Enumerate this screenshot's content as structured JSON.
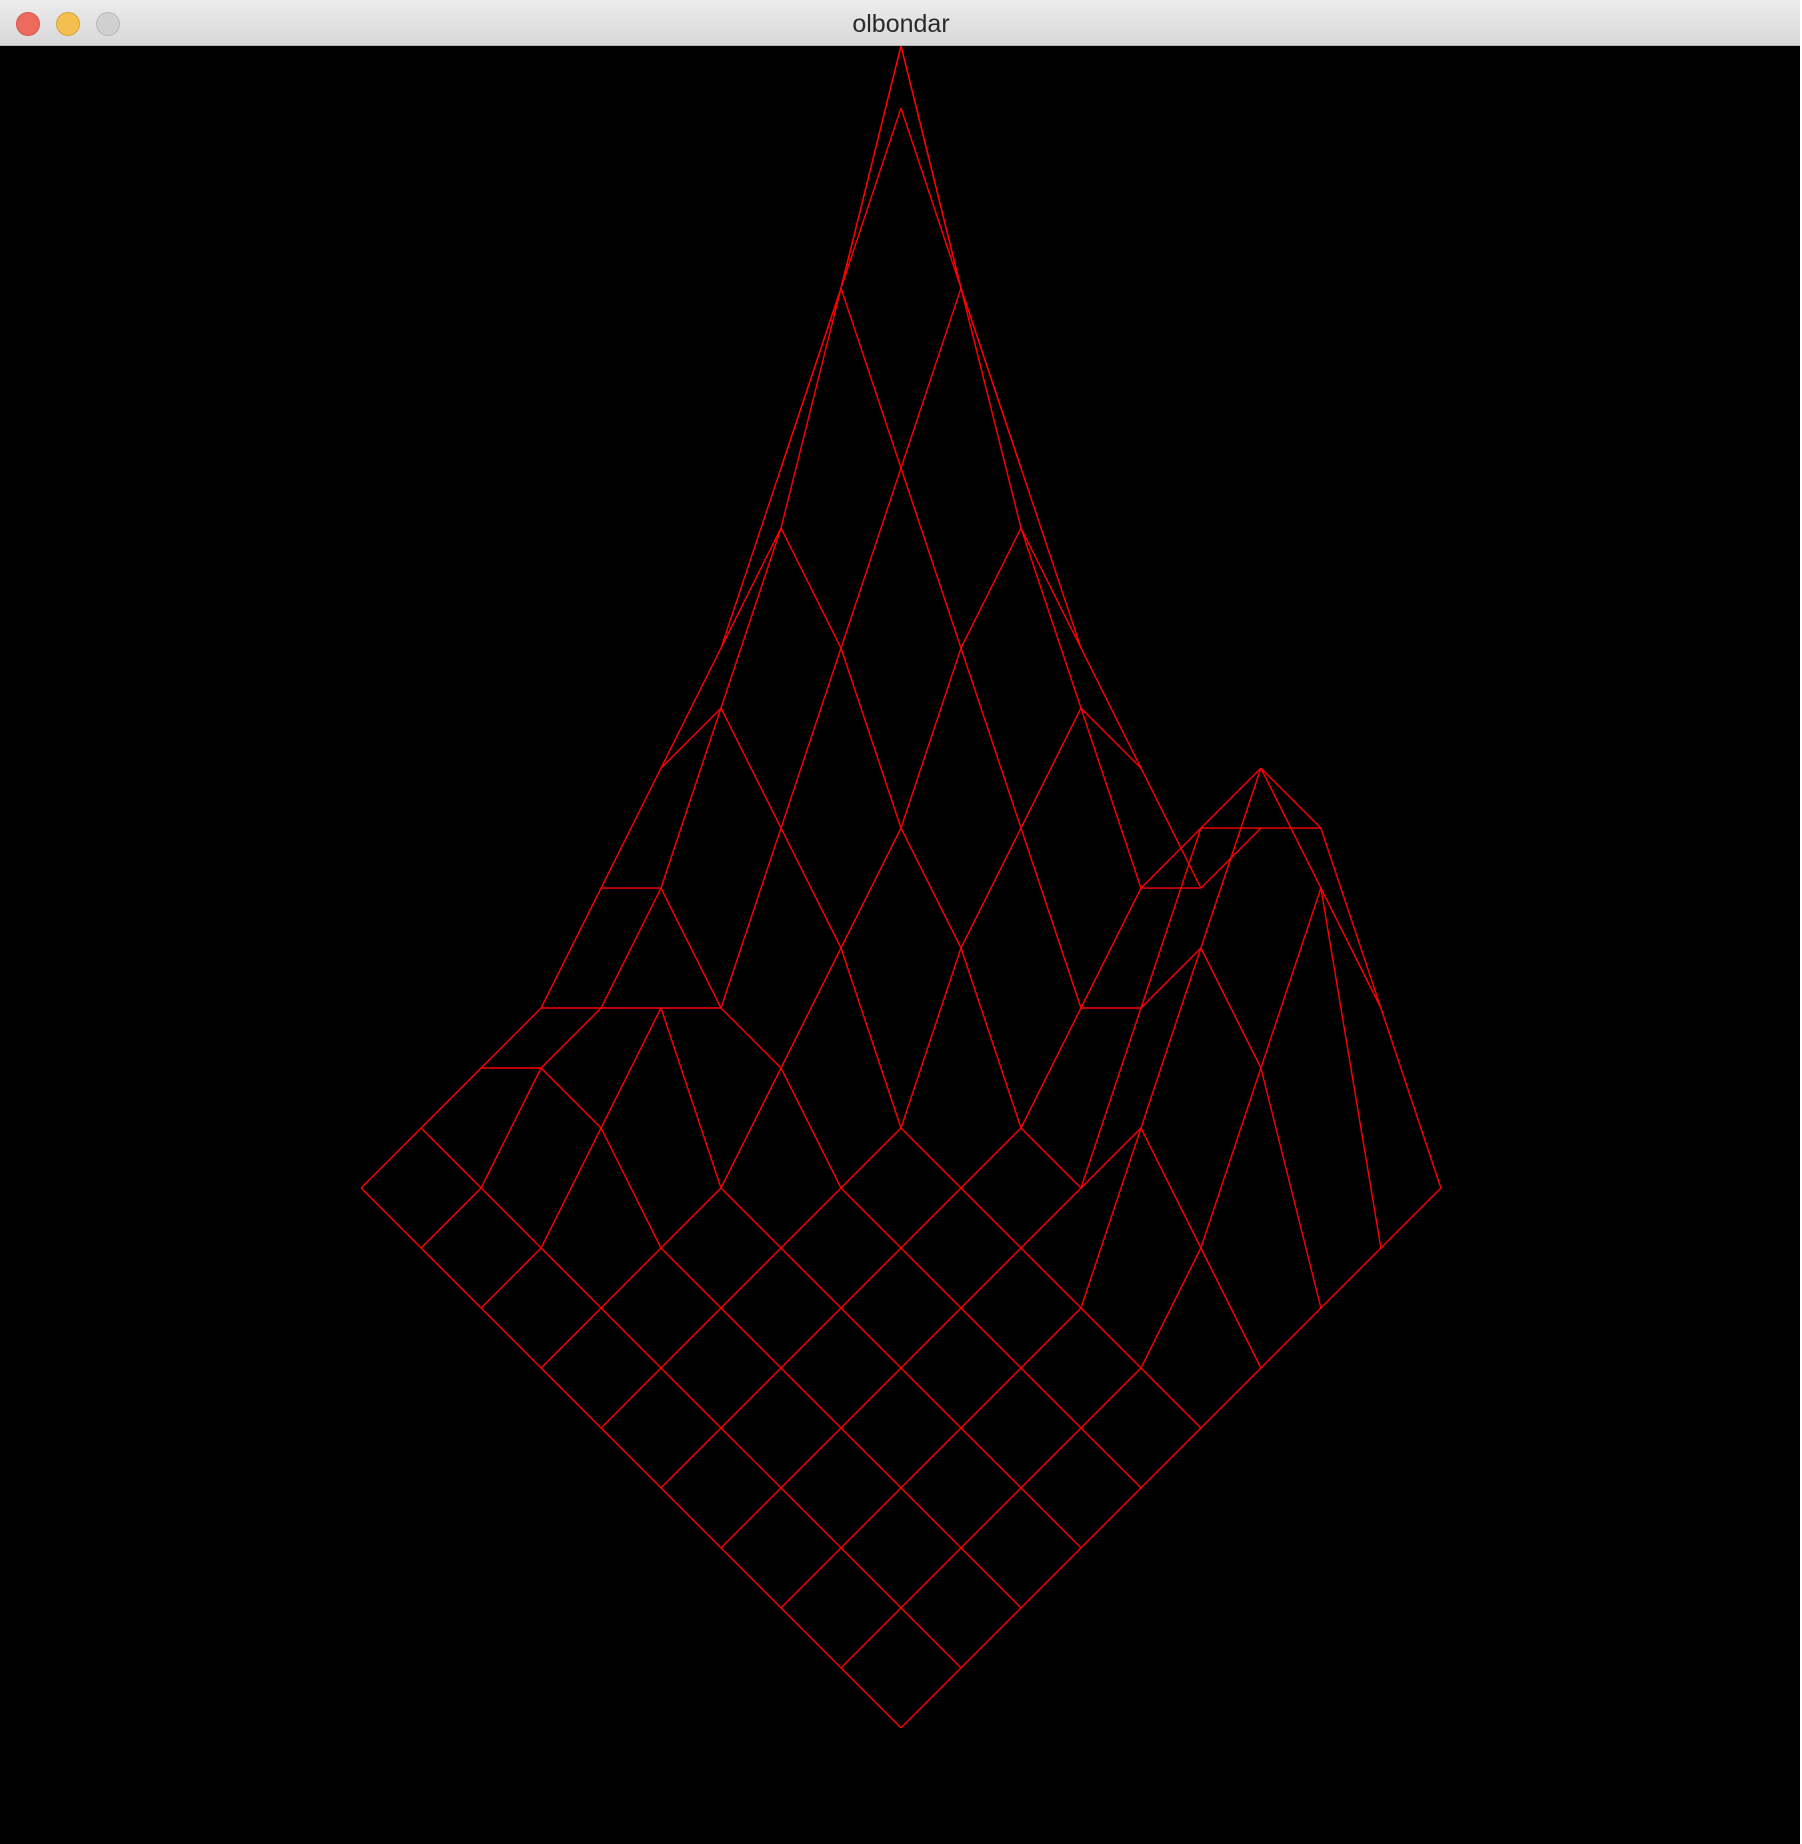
{
  "window": {
    "title": "olbondar"
  },
  "colors": {
    "background": "#000000",
    "wire": "#ff0000",
    "titlebar": "#e3e3e3"
  },
  "icons": [
    "close-icon",
    "minimize-icon",
    "zoom-icon"
  ]
}
